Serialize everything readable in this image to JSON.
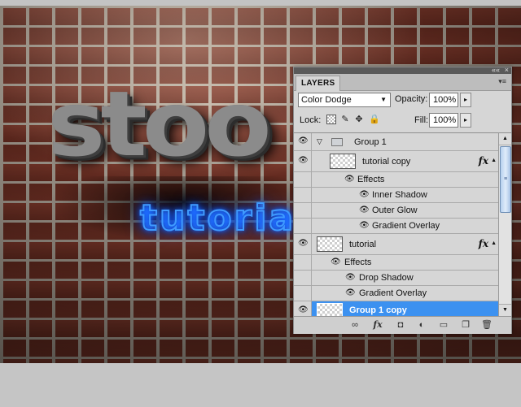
{
  "canvas": {
    "logo_text": "stoo",
    "subtitle_text": "tutoria"
  },
  "panel": {
    "tab_label": "LAYERS",
    "close_glyph": "×",
    "collapse_glyph": "««",
    "menu_glyph": "▾≡",
    "blend_mode": "Color Dodge",
    "opacity_label": "Opacity:",
    "opacity_value": "100%",
    "lock_label": "Lock:",
    "fill_label": "Fill:",
    "fill_value": "100%"
  },
  "layers": {
    "group1": {
      "name": "Group 1"
    },
    "tutorial_copy": {
      "name": "tutorial copy",
      "fx": "fx",
      "effects_label": "Effects",
      "effects": [
        "Inner Shadow",
        "Outer Glow",
        "Gradient Overlay"
      ]
    },
    "tutorial": {
      "name": "tutorial",
      "fx": "fx",
      "effects_label": "Effects",
      "effects": [
        "Drop Shadow",
        "Gradient Overlay"
      ]
    },
    "group1_copy": {
      "name": "Group 1 copy"
    }
  },
  "icons": {
    "eye": "👁",
    "expand_arrow": "▽",
    "fx_toggle": "▲",
    "brush": "✎",
    "move": "✥",
    "lock": "🔒",
    "link": "∞",
    "fx": "fx",
    "mask": "◘",
    "adjustment": "◐",
    "folder": "▭",
    "new_layer": "❐",
    "trash": "🗑",
    "scroll_up": "▲",
    "scroll_down": "▼",
    "scroll_grip": "≡",
    "select_caret": "▼",
    "arrow_right": "▸"
  },
  "colors": {
    "selected_row": "#3c91f0",
    "neon_blue": "#3f9bff"
  }
}
